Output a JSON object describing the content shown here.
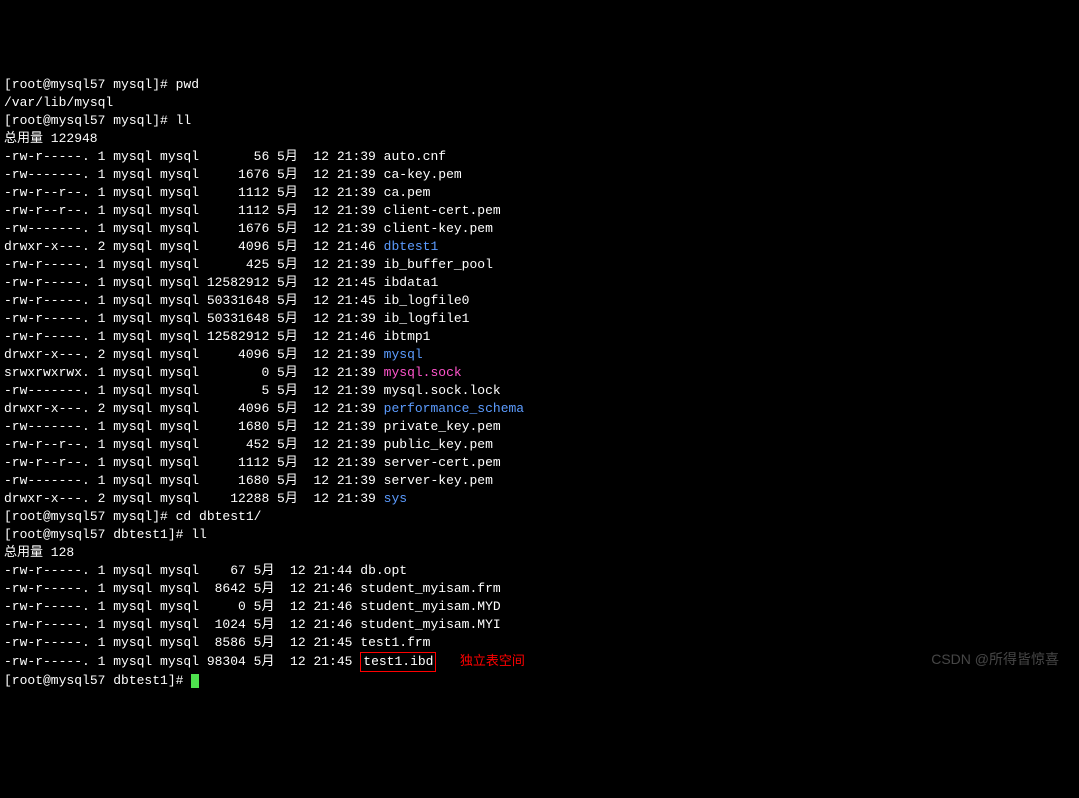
{
  "lines": {
    "l0": "[root@mysql57 mysql]# pwd",
    "l1": "/var/lib/mysql",
    "l2": "[root@mysql57 mysql]# ll",
    "l3": "总用量 122948",
    "l20": "[root@mysql57 mysql]# cd dbtest1/",
    "l21": "[root@mysql57 dbtest1]# ll",
    "l22": "总用量 128",
    "l29p": "[root@mysql57 dbtest1]# "
  },
  "ls_root": [
    {
      "perm": "-rw-r-----.",
      "n": "1",
      "u": "mysql",
      "g": "mysql",
      "size": "56",
      "mon": "5月",
      "day": "12",
      "time": "21:39",
      "name": "auto.cnf",
      "cls": ""
    },
    {
      "perm": "-rw-------.",
      "n": "1",
      "u": "mysql",
      "g": "mysql",
      "size": "1676",
      "mon": "5月",
      "day": "12",
      "time": "21:39",
      "name": "ca-key.pem",
      "cls": ""
    },
    {
      "perm": "-rw-r--r--.",
      "n": "1",
      "u": "mysql",
      "g": "mysql",
      "size": "1112",
      "mon": "5月",
      "day": "12",
      "time": "21:39",
      "name": "ca.pem",
      "cls": ""
    },
    {
      "perm": "-rw-r--r--.",
      "n": "1",
      "u": "mysql",
      "g": "mysql",
      "size": "1112",
      "mon": "5月",
      "day": "12",
      "time": "21:39",
      "name": "client-cert.pem",
      "cls": ""
    },
    {
      "perm": "-rw-------.",
      "n": "1",
      "u": "mysql",
      "g": "mysql",
      "size": "1676",
      "mon": "5月",
      "day": "12",
      "time": "21:39",
      "name": "client-key.pem",
      "cls": ""
    },
    {
      "perm": "drwxr-x---.",
      "n": "2",
      "u": "mysql",
      "g": "mysql",
      "size": "4096",
      "mon": "5月",
      "day": "12",
      "time": "21:46",
      "name": "dbtest1",
      "cls": "dir"
    },
    {
      "perm": "-rw-r-----.",
      "n": "1",
      "u": "mysql",
      "g": "mysql",
      "size": "425",
      "mon": "5月",
      "day": "12",
      "time": "21:39",
      "name": "ib_buffer_pool",
      "cls": ""
    },
    {
      "perm": "-rw-r-----.",
      "n": "1",
      "u": "mysql",
      "g": "mysql",
      "size": "12582912",
      "mon": "5月",
      "day": "12",
      "time": "21:45",
      "name": "ibdata1",
      "cls": ""
    },
    {
      "perm": "-rw-r-----.",
      "n": "1",
      "u": "mysql",
      "g": "mysql",
      "size": "50331648",
      "mon": "5月",
      "day": "12",
      "time": "21:45",
      "name": "ib_logfile0",
      "cls": ""
    },
    {
      "perm": "-rw-r-----.",
      "n": "1",
      "u": "mysql",
      "g": "mysql",
      "size": "50331648",
      "mon": "5月",
      "day": "12",
      "time": "21:39",
      "name": "ib_logfile1",
      "cls": ""
    },
    {
      "perm": "-rw-r-----.",
      "n": "1",
      "u": "mysql",
      "g": "mysql",
      "size": "12582912",
      "mon": "5月",
      "day": "12",
      "time": "21:46",
      "name": "ibtmp1",
      "cls": ""
    },
    {
      "perm": "drwxr-x---.",
      "n": "2",
      "u": "mysql",
      "g": "mysql",
      "size": "4096",
      "mon": "5月",
      "day": "12",
      "time": "21:39",
      "name": "mysql",
      "cls": "dir"
    },
    {
      "perm": "srwxrwxrwx.",
      "n": "1",
      "u": "mysql",
      "g": "mysql",
      "size": "0",
      "mon": "5月",
      "day": "12",
      "time": "21:39",
      "name": "mysql.sock",
      "cls": "sock"
    },
    {
      "perm": "-rw-------.",
      "n": "1",
      "u": "mysql",
      "g": "mysql",
      "size": "5",
      "mon": "5月",
      "day": "12",
      "time": "21:39",
      "name": "mysql.sock.lock",
      "cls": ""
    },
    {
      "perm": "drwxr-x---.",
      "n": "2",
      "u": "mysql",
      "g": "mysql",
      "size": "4096",
      "mon": "5月",
      "day": "12",
      "time": "21:39",
      "name": "performance_schema",
      "cls": "dir"
    },
    {
      "perm": "-rw-------.",
      "n": "1",
      "u": "mysql",
      "g": "mysql",
      "size": "1680",
      "mon": "5月",
      "day": "12",
      "time": "21:39",
      "name": "private_key.pem",
      "cls": ""
    },
    {
      "perm": "-rw-r--r--.",
      "n": "1",
      "u": "mysql",
      "g": "mysql",
      "size": "452",
      "mon": "5月",
      "day": "12",
      "time": "21:39",
      "name": "public_key.pem",
      "cls": ""
    },
    {
      "perm": "-rw-r--r--.",
      "n": "1",
      "u": "mysql",
      "g": "mysql",
      "size": "1112",
      "mon": "5月",
      "day": "12",
      "time": "21:39",
      "name": "server-cert.pem",
      "cls": ""
    },
    {
      "perm": "-rw-------.",
      "n": "1",
      "u": "mysql",
      "g": "mysql",
      "size": "1680",
      "mon": "5月",
      "day": "12",
      "time": "21:39",
      "name": "server-key.pem",
      "cls": ""
    },
    {
      "perm": "drwxr-x---.",
      "n": "2",
      "u": "mysql",
      "g": "mysql",
      "size": "12288",
      "mon": "5月",
      "day": "12",
      "time": "21:39",
      "name": "sys",
      "cls": "dir"
    }
  ],
  "ls_db": [
    {
      "perm": "-rw-r-----.",
      "n": "1",
      "u": "mysql",
      "g": "mysql",
      "size": "67",
      "mon": "5月",
      "day": "12",
      "time": "21:44",
      "name": "db.opt"
    },
    {
      "perm": "-rw-r-----.",
      "n": "1",
      "u": "mysql",
      "g": "mysql",
      "size": "8642",
      "mon": "5月",
      "day": "12",
      "time": "21:46",
      "name": "student_myisam.frm"
    },
    {
      "perm": "-rw-r-----.",
      "n": "1",
      "u": "mysql",
      "g": "mysql",
      "size": "0",
      "mon": "5月",
      "day": "12",
      "time": "21:46",
      "name": "student_myisam.MYD"
    },
    {
      "perm": "-rw-r-----.",
      "n": "1",
      "u": "mysql",
      "g": "mysql",
      "size": "1024",
      "mon": "5月",
      "day": "12",
      "time": "21:46",
      "name": "student_myisam.MYI"
    },
    {
      "perm": "-rw-r-----.",
      "n": "1",
      "u": "mysql",
      "g": "mysql",
      "size": "8586",
      "mon": "5月",
      "day": "12",
      "time": "21:45",
      "name": "test1.frm"
    }
  ],
  "highlight": {
    "perm": "-rw-r-----.",
    "n": "1",
    "u": "mysql",
    "g": "mysql",
    "size": "98304",
    "mon": "5月",
    "day": "12",
    "time": "21:45",
    "name": "test1.ibd",
    "note": "独立表空间"
  },
  "watermark": "CSDN @所得皆惊喜"
}
